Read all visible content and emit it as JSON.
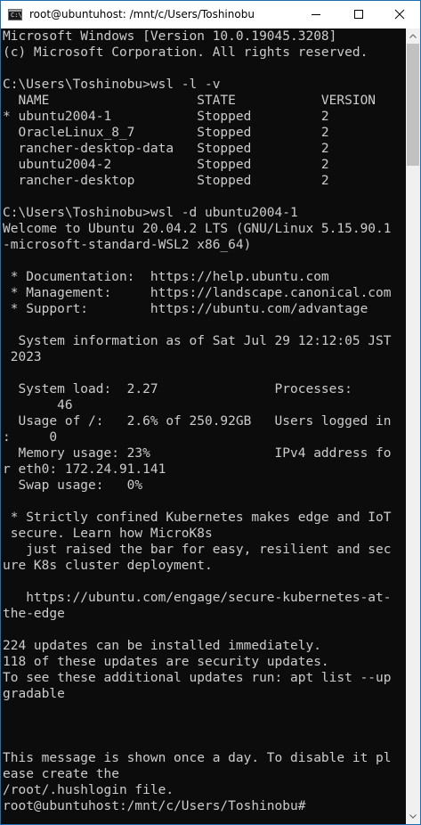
{
  "window": {
    "title": "root@ubuntuhost: /mnt/c/Users/Toshinobu",
    "icon": "console-icon",
    "icon_label": "C:\\",
    "controls": [
      "minimize-icon",
      "maximize-icon",
      "close-icon"
    ]
  },
  "terminal": {
    "lines": [
      "Microsoft Windows [Version 10.0.19045.3208]",
      "(c) Microsoft Corporation. All rights reserved.",
      "",
      "C:\\Users\\Toshinobu>wsl -l -v",
      "  NAME                   STATE           VERSION",
      "* ubuntu2004-1           Stopped         2",
      "  OracleLinux_8_7        Stopped         2",
      "  rancher-desktop-data   Stopped         2",
      "  ubuntu2004-2           Stopped         2",
      "  rancher-desktop        Stopped         2",
      "",
      "C:\\Users\\Toshinobu>wsl -d ubuntu2004-1",
      "Welcome to Ubuntu 20.04.2 LTS (GNU/Linux 5.15.90.1",
      "-microsoft-standard-WSL2 x86_64)",
      "",
      " * Documentation:  https://help.ubuntu.com",
      " * Management:     https://landscape.canonical.com",
      " * Support:        https://ubuntu.com/advantage",
      "",
      "  System information as of Sat Jul 29 12:12:05 JST",
      " 2023",
      "",
      "  System load:  2.27               Processes:",
      "       46",
      "  Usage of /:   2.6% of 250.92GB   Users logged in",
      ":     0",
      "  Memory usage: 23%                IPv4 address fo",
      "r eth0: 172.24.91.141",
      "  Swap usage:   0%",
      "",
      " * Strictly confined Kubernetes makes edge and IoT",
      " secure. Learn how MicroK8s",
      "   just raised the bar for easy, resilient and sec",
      "ure K8s cluster deployment.",
      "",
      "   https://ubuntu.com/engage/secure-kubernetes-at-",
      "the-edge",
      "",
      "224 updates can be installed immediately.",
      "118 of these updates are security updates.",
      "To see these additional updates run: apt list --up",
      "gradable",
      "",
      "",
      "",
      "This message is shown once a day. To disable it pl",
      "ease create the",
      "/root/.hushlogin file.",
      "root@ubuntuhost:/mnt/c/Users/Toshinobu#"
    ]
  },
  "colors": {
    "terminal_bg": "#0c0c0c",
    "terminal_fg": "#cccccc",
    "titlebar_bg": "#ffffff",
    "scrollbar_bg": "#f0f0f0",
    "scrollbar_thumb": "#c1c1c1",
    "window_border": "#1f6fb2"
  }
}
